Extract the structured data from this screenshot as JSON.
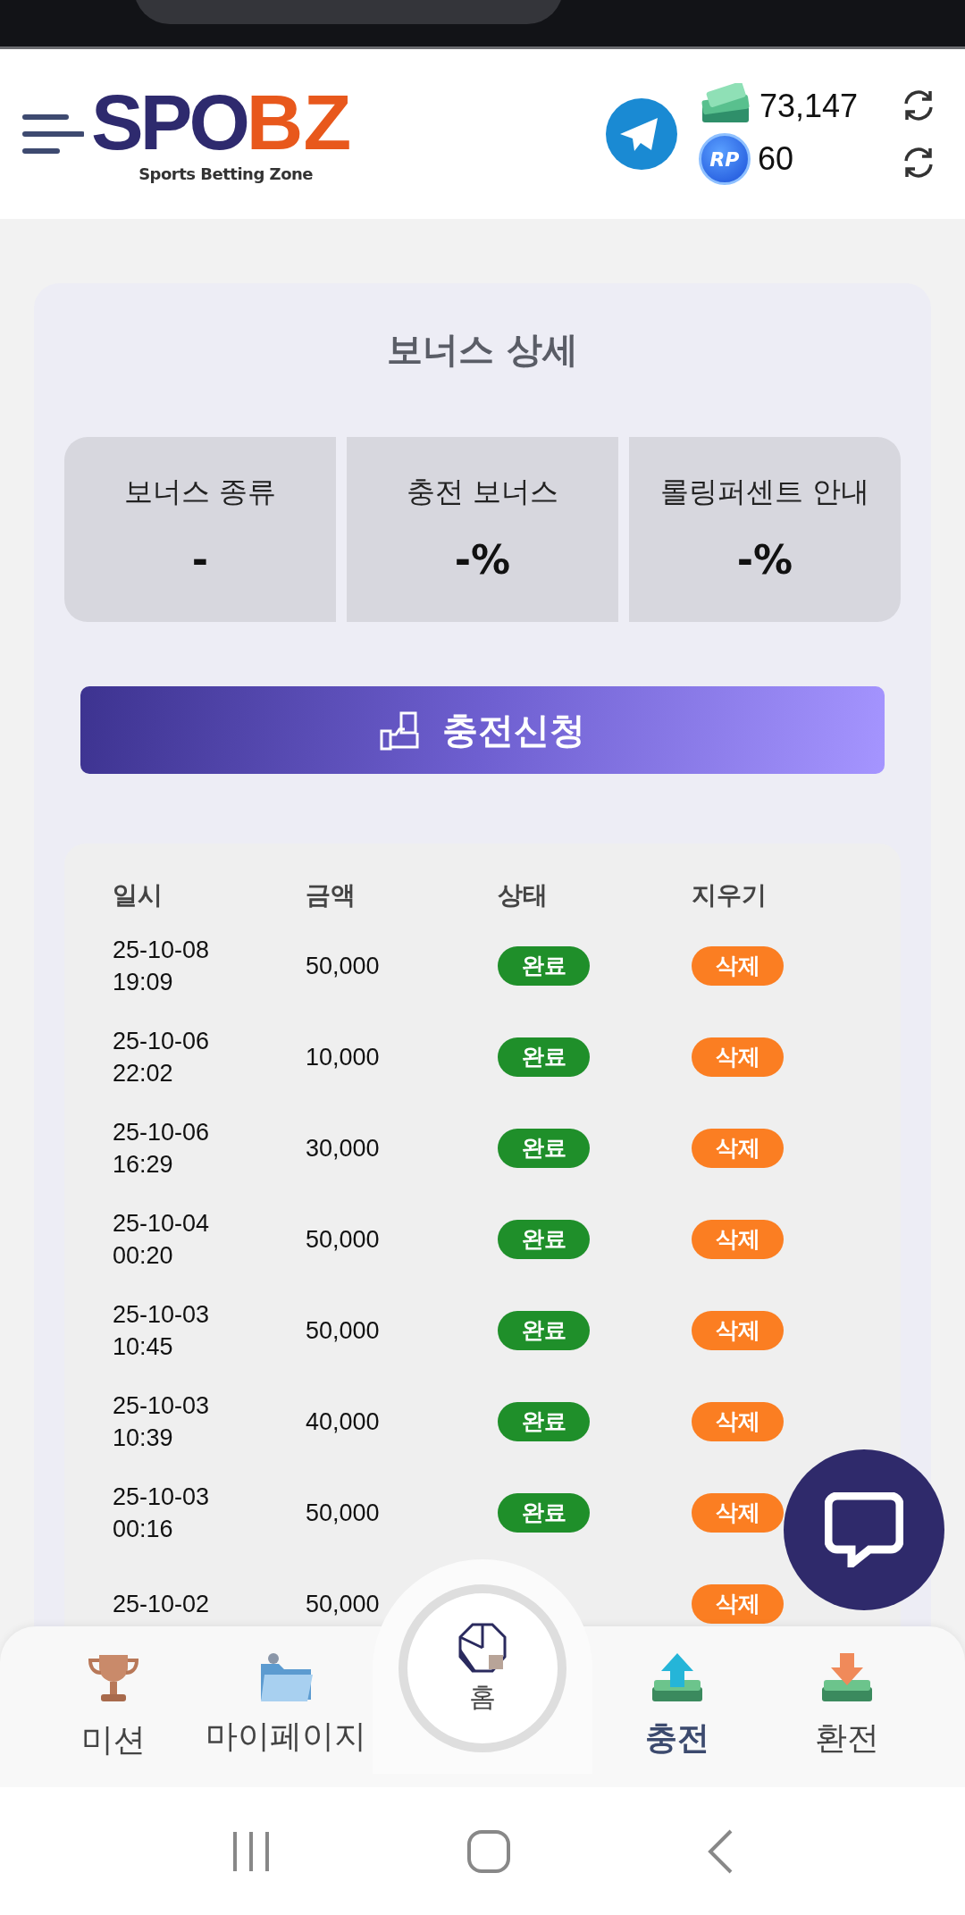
{
  "header": {
    "logo": {
      "parts": [
        "SPO",
        "BZ"
      ],
      "tagline": "Sports Betting Zone"
    },
    "balances": [
      {
        "kind": "cash",
        "value": "73,147"
      },
      {
        "kind": "coin",
        "coin_label": "RP",
        "value": "60"
      }
    ]
  },
  "bonus": {
    "title": "보너스 상세",
    "boxes": [
      {
        "label": "보너스 종류",
        "value": "-"
      },
      {
        "label": "충전 보너스",
        "value": "-%"
      },
      {
        "label": "롤링퍼센트 안내",
        "value": "-%"
      }
    ],
    "button": "충전신청"
  },
  "table": {
    "columns": [
      "일시",
      "금액",
      "상태",
      "지우기"
    ],
    "rows": [
      {
        "date": "25-10-08",
        "time": "19:09",
        "amount": "50,000",
        "status": "완료",
        "action": "삭제"
      },
      {
        "date": "25-10-06",
        "time": "22:02",
        "amount": "10,000",
        "status": "완료",
        "action": "삭제"
      },
      {
        "date": "25-10-06",
        "time": "16:29",
        "amount": "30,000",
        "status": "완료",
        "action": "삭제"
      },
      {
        "date": "25-10-04",
        "time": "00:20",
        "amount": "50,000",
        "status": "완료",
        "action": "삭제"
      },
      {
        "date": "25-10-03",
        "time": "10:45",
        "amount": "50,000",
        "status": "완료",
        "action": "삭제"
      },
      {
        "date": "25-10-03",
        "time": "10:39",
        "amount": "40,000",
        "status": "완료",
        "action": "삭제"
      },
      {
        "date": "25-10-03",
        "time": "00:16",
        "amount": "50,000",
        "status": "완료",
        "action": "삭제"
      },
      {
        "date": "25-10-02",
        "amount": "50,000",
        "action": "삭제"
      }
    ]
  },
  "bottom_nav": [
    {
      "kind": "trophy",
      "label": "미션",
      "selected": false
    },
    {
      "kind": "folder",
      "label": "마이페이지",
      "selected": false
    },
    {
      "kind": "home",
      "label": "홈",
      "selected": false
    },
    {
      "kind": "deposit",
      "label": "충전",
      "selected": true
    },
    {
      "kind": "withdraw",
      "label": "환전",
      "selected": false
    }
  ]
}
